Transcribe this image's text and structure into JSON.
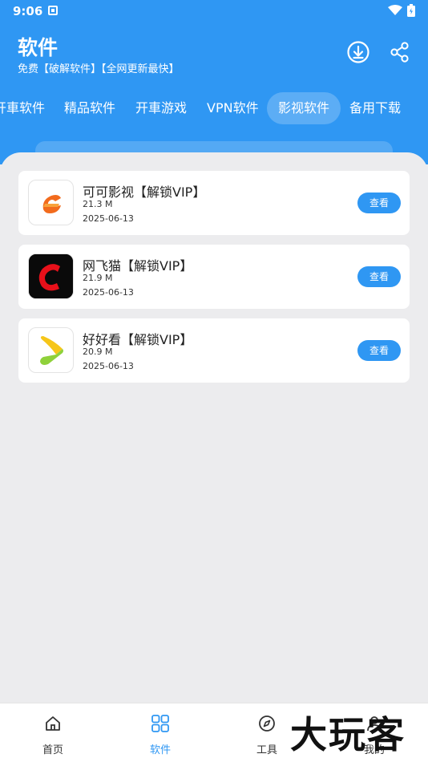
{
  "status": {
    "time": "9:06"
  },
  "header": {
    "title": "软件",
    "subtitle": "免费【破解软件】【全网更新最快】",
    "download_icon": "download-icon",
    "share_icon": "share-icon"
  },
  "tabs": [
    {
      "label": "开車软件",
      "active": false
    },
    {
      "label": "精品软件",
      "active": false
    },
    {
      "label": "开車游戏",
      "active": false
    },
    {
      "label": "VPN软件",
      "active": false
    },
    {
      "label": "影视软件",
      "active": true
    },
    {
      "label": "备用下载",
      "active": false
    }
  ],
  "apps": [
    {
      "name": "可可影视【解锁VIP】",
      "size": "21.3 M",
      "date": "2025-06-13",
      "button": "查看",
      "icon": "keke-logo-icon"
    },
    {
      "name": "网飞猫【解锁VIP】",
      "size": "21.9 M",
      "date": "2025-06-13",
      "button": "查看",
      "icon": "netflix-cat-logo-icon"
    },
    {
      "name": "好好看【解锁VIP】",
      "size": "20.9 M",
      "date": "2025-06-13",
      "button": "查看",
      "icon": "haohaokan-logo-icon"
    }
  ],
  "bottom_nav": [
    {
      "label": "首页",
      "icon": "home-icon",
      "active": false
    },
    {
      "label": "软件",
      "icon": "grid-icon",
      "active": true
    },
    {
      "label": "工具",
      "icon": "compass-icon",
      "active": false
    },
    {
      "label": "我的",
      "icon": "user-icon",
      "active": false
    }
  ],
  "watermark": "大玩客",
  "colors": {
    "primary": "#2f97f3",
    "background": "#ececee"
  }
}
